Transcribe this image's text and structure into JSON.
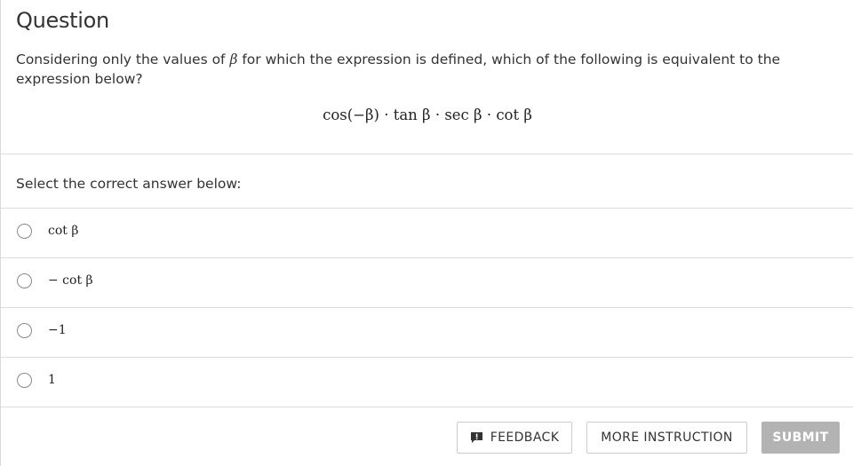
{
  "question": {
    "title": "Question",
    "text_before": "Considering only the values of ",
    "symbol": "β",
    "text_after": " for which the expression is defined, which of the following is equivalent to the expression below?",
    "expression": "cos(−β) · tan β · sec β · cot β"
  },
  "answers": {
    "prompt": "Select the correct answer below:",
    "options": [
      {
        "label": "cot β"
      },
      {
        "label": "− cot β"
      },
      {
        "label": "−1"
      },
      {
        "label": "1"
      }
    ]
  },
  "buttons": {
    "feedback": "FEEDBACK",
    "more_instruction": "MORE INSTRUCTION",
    "submit": "SUBMIT"
  },
  "icons": {
    "feedback": "feedback-icon"
  },
  "colors": {
    "submit_bg": "#b3b3b3",
    "divider": "#dedede",
    "text": "#333333"
  }
}
